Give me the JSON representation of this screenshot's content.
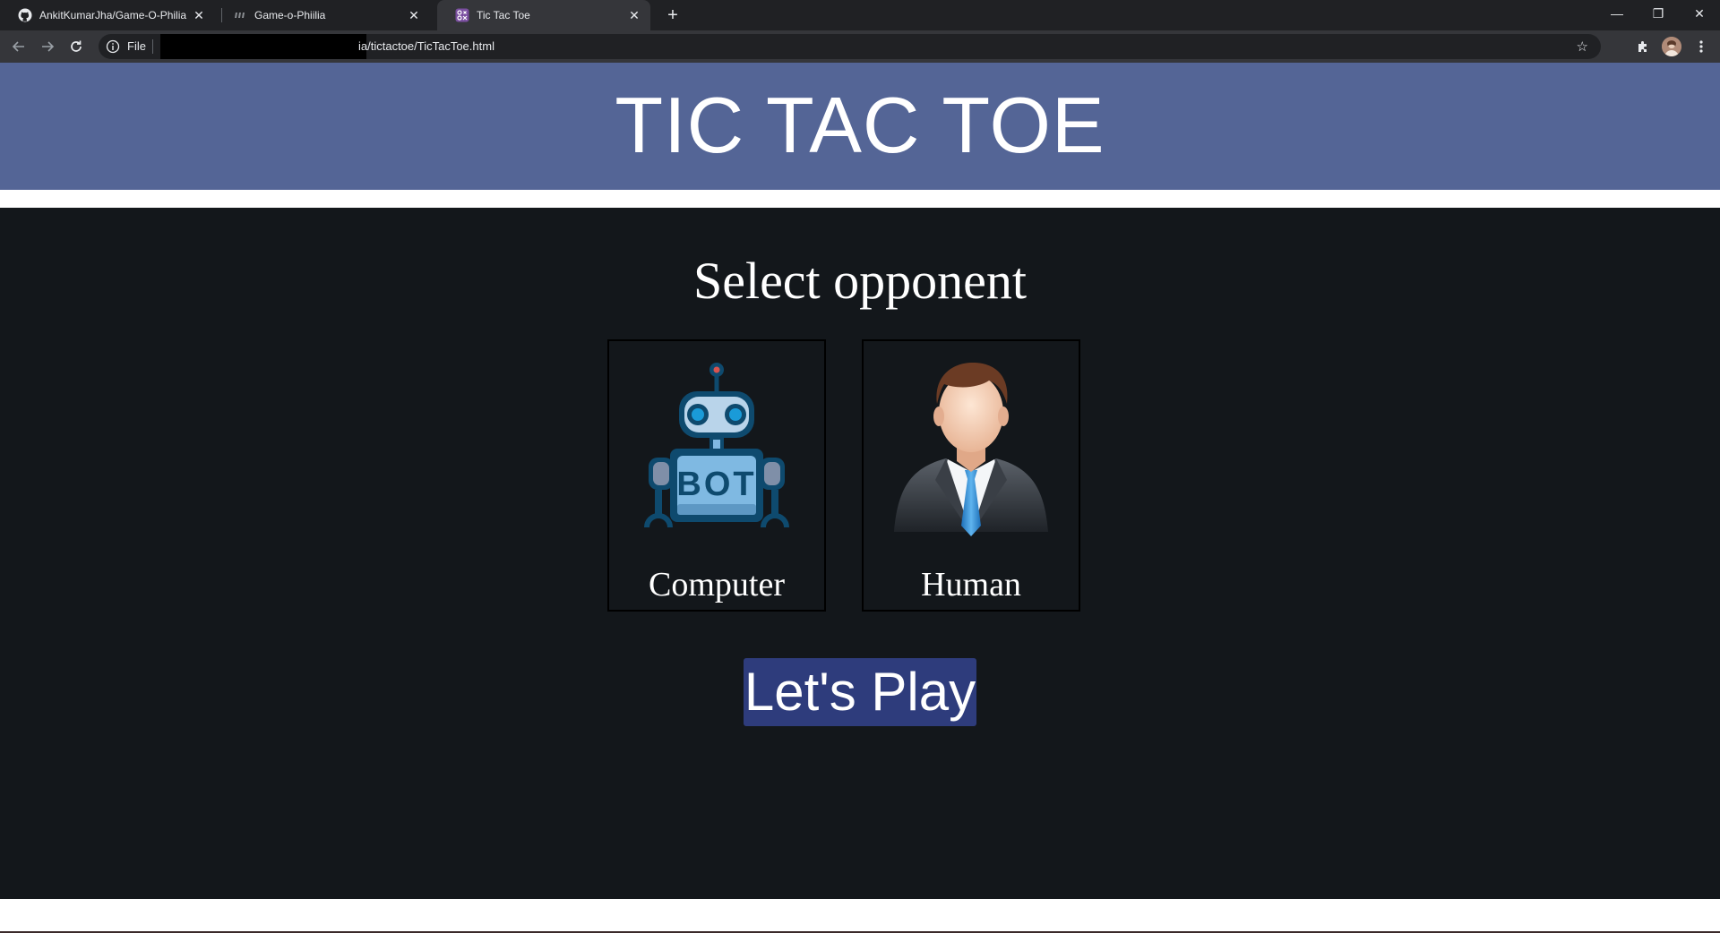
{
  "browser": {
    "tabs": [
      {
        "title": "AnkitKumarJha/Game-O-Philia",
        "icon": "github-icon",
        "active": false
      },
      {
        "title": "Game-o-Phiilia",
        "icon": "game-icon",
        "active": false
      },
      {
        "title": "Tic Tac Toe",
        "icon": "tictactoe-icon",
        "active": true
      }
    ],
    "address": {
      "scheme_label": "File",
      "url": "ia/tictactoe/TicTacToe.html"
    }
  },
  "page": {
    "title": "TIC TAC TOE",
    "subtitle": "Select opponent",
    "options": [
      {
        "label": "Computer",
        "image": "robot-bot-icon",
        "image_text": "BOT"
      },
      {
        "label": "Human",
        "image": "businessman-avatar-icon"
      }
    ],
    "play_button": "Let's Play"
  },
  "colors": {
    "header_bg": "#546596",
    "main_bg": "#13171b",
    "button_bg": "#2e3c7c",
    "robot_primary": "#0e4a6e",
    "robot_light": "#7fb9e2"
  }
}
